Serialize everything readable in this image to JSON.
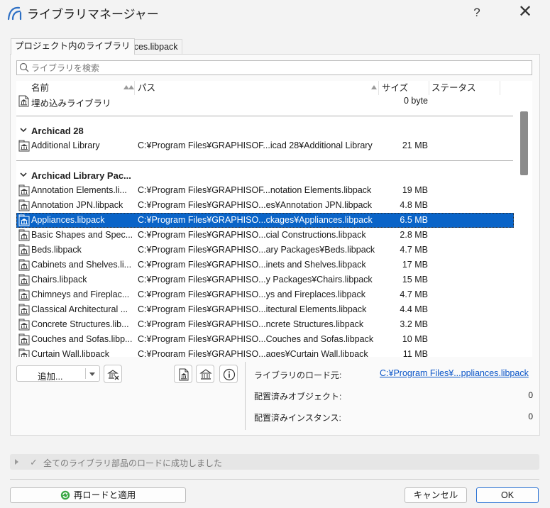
{
  "window": {
    "title": "ライブラリマネージャー",
    "help": "?",
    "close": "✕"
  },
  "tabs": [
    {
      "label": "プロジェクト内のライブラリ",
      "active": true
    },
    {
      "label": "Appliances.libpack",
      "active": false
    }
  ],
  "search": {
    "placeholder": "ライブラリを検索"
  },
  "columns": {
    "name": "名前",
    "path": "パス",
    "size": "サイズ",
    "status": "ステータス"
  },
  "embedded": {
    "name": "埋め込みライブラリ",
    "size": "0 byte"
  },
  "groups": [
    {
      "label": "Archicad 28",
      "rows": [
        {
          "name": "Additional Library",
          "path": "C:¥Program Files¥GRAPHISOF...icad 28¥Additional Library",
          "size": "21 MB"
        }
      ]
    },
    {
      "label": "Archicad Library Pac...",
      "rows": [
        {
          "name": "Annotation Elements.li...",
          "path": "C:¥Program Files¥GRAPHISOF...notation Elements.libpack",
          "size": "19 MB"
        },
        {
          "name": "Annotation JPN.libpack",
          "path": "C:¥Program Files¥GRAPHISO...es¥Annotation JPN.libpack",
          "size": "4.8 MB"
        },
        {
          "name": "Appliances.libpack",
          "path": "C:¥Program Files¥GRAPHISO...ckages¥Appliances.libpack",
          "size": "6.5 MB",
          "selected": true
        },
        {
          "name": "Basic Shapes and Spec...",
          "path": "C:¥Program Files¥GRAPHISO...cial Constructions.libpack",
          "size": "2.8 MB"
        },
        {
          "name": "Beds.libpack",
          "path": "C:¥Program Files¥GRAPHISO...ary Packages¥Beds.libpack",
          "size": "4.7 MB"
        },
        {
          "name": "Cabinets and Shelves.li...",
          "path": "C:¥Program Files¥GRAPHISO...inets and Shelves.libpack",
          "size": "17 MB"
        },
        {
          "name": "Chairs.libpack",
          "path": "C:¥Program Files¥GRAPHISO...y Packages¥Chairs.libpack",
          "size": "15 MB"
        },
        {
          "name": "Chimneys and Fireplac...",
          "path": "C:¥Program Files¥GRAPHISO...ys and Fireplaces.libpack",
          "size": "4.7 MB"
        },
        {
          "name": "Classical Architectural ...",
          "path": "C:¥Program Files¥GRAPHISO...itectural Elements.libpack",
          "size": "4.4 MB"
        },
        {
          "name": "Concrete Structures.lib...",
          "path": "C:¥Program Files¥GRAPHISO...ncrete Structures.libpack",
          "size": "3.2 MB"
        },
        {
          "name": "Couches and Sofas.libp...",
          "path": "C:¥Program Files¥GRAPHISO...Couches and Sofas.libpack",
          "size": "10 MB"
        },
        {
          "name": "Curtain Wall.libpack",
          "path": "C:¥Program Files¥GRAPHISO...ages¥Curtain Wall.libpack",
          "size": "11 MB"
        }
      ]
    }
  ],
  "toolbar": {
    "add_label": "追加..."
  },
  "info": {
    "load_source_label": "ライブラリのロード元:",
    "load_source_value": "C:¥Program Files¥...ppliances.libpack",
    "placed_objects_label": "配置済みオブジェクト:",
    "placed_objects_value": "0",
    "placed_instances_label": "配置済みインスタンス:",
    "placed_instances_value": "0"
  },
  "status": {
    "message": "全てのライブラリ部品のロードに成功しました"
  },
  "footer": {
    "reload_label": "再ロードと適用",
    "cancel_label": "キャンセル",
    "ok_label": "OK"
  },
  "colors": {
    "selection": "#0a64c8",
    "link": "#0a55c8",
    "ok_border": "#2a72d4"
  }
}
